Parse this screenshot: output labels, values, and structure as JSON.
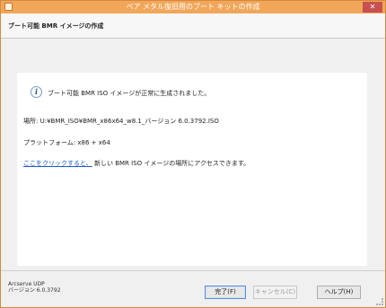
{
  "window": {
    "title": "ベア メタル復旧用のブート キットの作成",
    "close_glyph": "✕"
  },
  "header": {
    "heading": "ブート可能 BMR イメージの作成"
  },
  "content": {
    "info_icon_glyph": "i",
    "message": "ブート可能 BMR ISO イメージが正常に生成されました。",
    "location": "場所: U:¥BMR_ISO¥BMR_x86x64_w8.1_バージョン 6.0.3792.ISO",
    "platform": "プラットフォーム: x86 + x64",
    "link_text": "ここをクリックすると、",
    "link_suffix": "新しい BMR ISO イメージの場所にアクセスできます。"
  },
  "footer": {
    "product_name": "Arcserve UDP",
    "product_version": "バージョン 6.0.3792",
    "finish_label": "完了(F)",
    "cancel_label": "キャンセル(C)",
    "help_label": "ヘルプ(H)"
  },
  "colors": {
    "titlebar": "#f2a65a",
    "close_button": "#c75050",
    "link": "#1a5cc8"
  }
}
